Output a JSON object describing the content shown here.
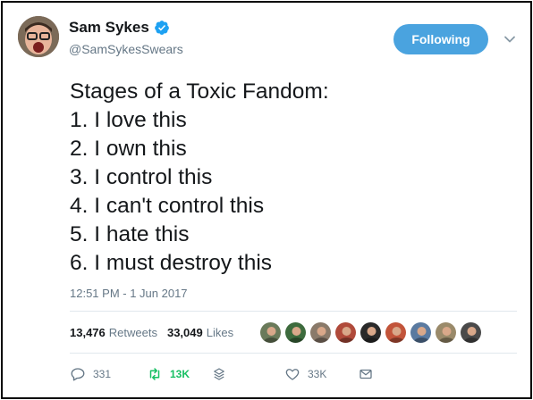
{
  "author": {
    "display_name": "Sam Sykes",
    "handle": "@SamSykesSwears",
    "verified": true
  },
  "follow_button": {
    "label": "Following"
  },
  "tweet": {
    "lines": [
      "Stages of a Toxic Fandom:",
      "1. I love this",
      "2. I own this",
      "3. I control this",
      "4. I can't control this",
      "5. I hate this",
      "6. I must destroy this"
    ],
    "timestamp": "12:51 PM - 1 Jun 2017"
  },
  "stats": {
    "retweets_count": "13,476",
    "retweets_label": "Retweets",
    "likes_count": "33,049",
    "likes_label": "Likes",
    "liker_avatar_colors": [
      "#6a7a5a",
      "#3d6b3d",
      "#8a7a6a",
      "#b04a3a",
      "#2a2a2a",
      "#c2543a",
      "#5a7aa0",
      "#9a8a6a",
      "#4a4a4a"
    ]
  },
  "actions": {
    "reply_count": "331",
    "retweet_count": "13K",
    "like_count": "33K"
  },
  "colors": {
    "accent": "#4aa3df",
    "retweet_green": "#17bf63",
    "verified_blue": "#1da1f2",
    "muted": "#657786"
  }
}
